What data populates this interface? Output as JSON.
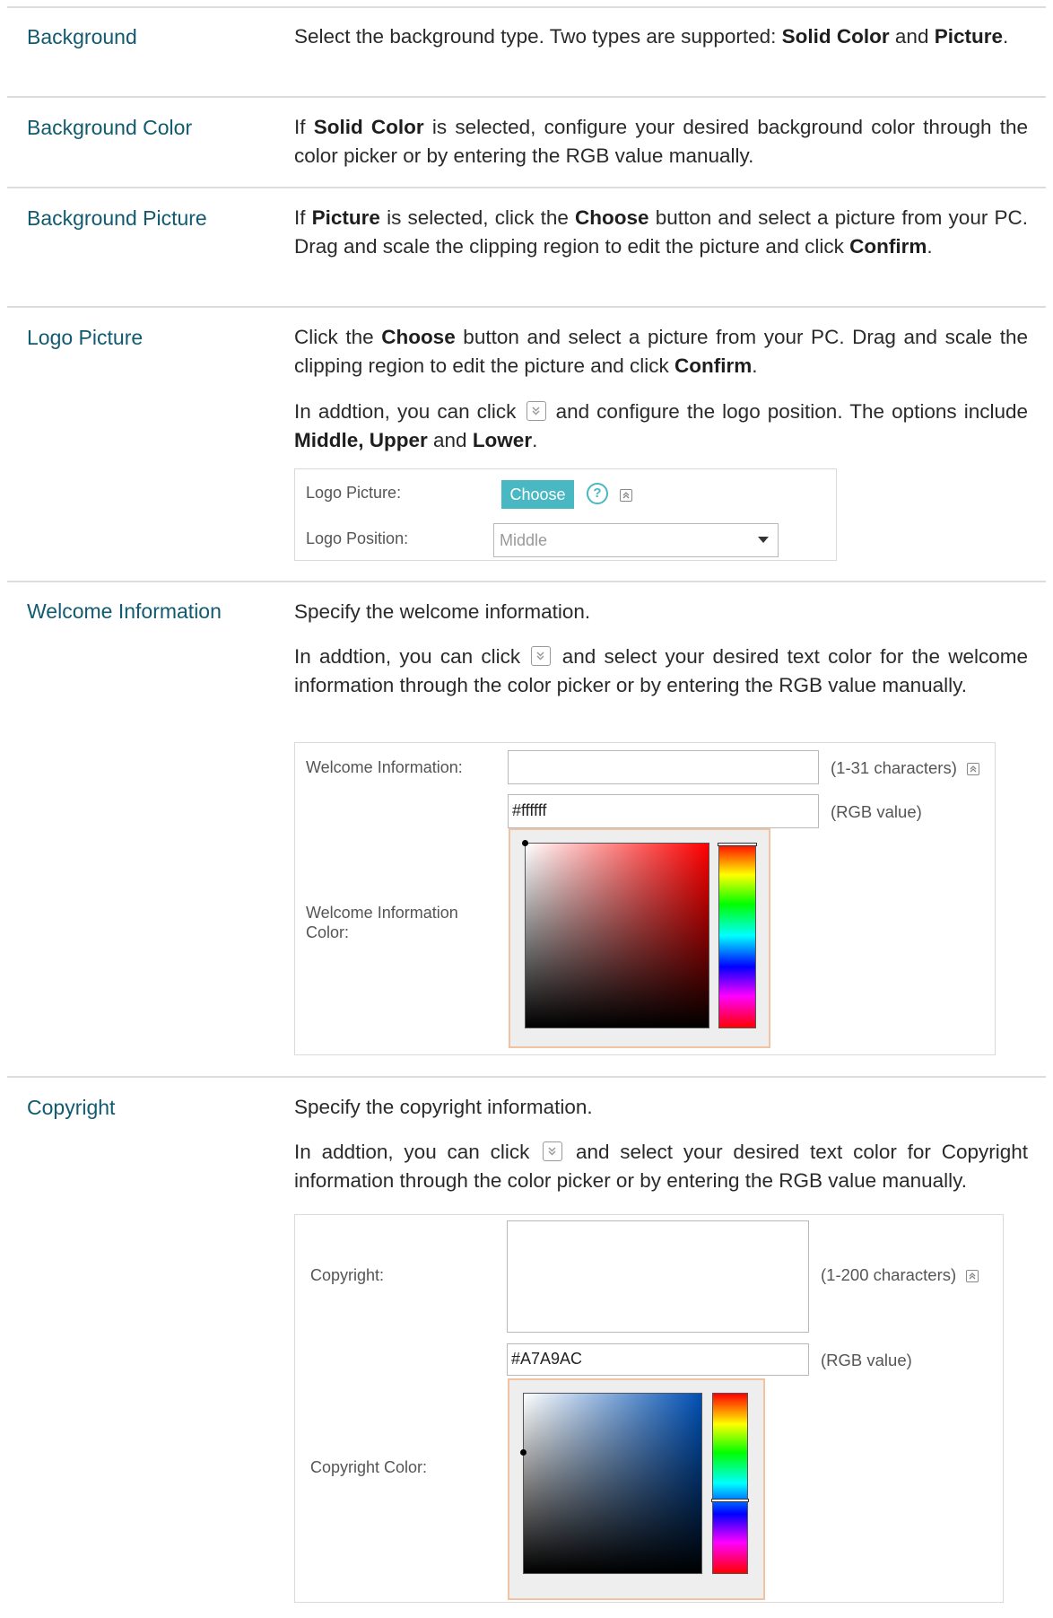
{
  "rows": [
    {
      "term": "Background",
      "paras": [
        [
          "Select the background type. Two types are supported: ",
          {
            "b": "Solid Color"
          },
          " and ",
          {
            "b": "Picture"
          },
          "."
        ]
      ]
    },
    {
      "term": "Background Color",
      "paras": [
        [
          "If ",
          {
            "b": "Solid Color"
          },
          " is selected, configure your desired background color through the color picker or by entering the RGB value manually."
        ]
      ]
    },
    {
      "term": "Background Picture",
      "paras": [
        [
          "If ",
          {
            "b": "Picture"
          },
          " is selected, click the ",
          {
            "b": "Choose"
          },
          " button and select a picture from your PC. Drag and scale the clipping region to edit the picture and click ",
          {
            "b": "Confirm"
          },
          "."
        ]
      ]
    },
    {
      "term": "Logo Picture",
      "paras": [
        [
          "Click the ",
          {
            "b": "Choose"
          },
          " button and select a picture from your PC. Drag and scale the clipping region to edit the picture and click ",
          {
            "b": "Confirm"
          },
          "."
        ],
        [
          "In addtion, you can click ",
          {
            "icon": "expand-icon"
          },
          " and configure the logo position. The options include ",
          {
            "b": "Middle, Upper"
          },
          " and ",
          {
            "b": "Lower"
          },
          "."
        ]
      ]
    },
    {
      "term": "Welcome Information",
      "paras": [
        [
          "Specify the welcome information."
        ],
        [
          "In addtion, you can click ",
          {
            "icon": "expand-icon"
          },
          " and select your desired text color for the welcome information through the color picker or by entering the RGB value manually."
        ]
      ]
    },
    {
      "term": "Copyright",
      "paras": [
        [
          "Specify the copyright information."
        ],
        [
          "In addtion, you can click ",
          {
            "icon": "expand-icon"
          },
          " and select your desired text color for Copyright information through the color picker or by entering the RGB value manually."
        ]
      ]
    }
  ],
  "logo_panel": {
    "logo_picture_label": "Logo Picture:",
    "choose_button": "Choose",
    "help_icon": "?",
    "collapse_icon": "collapse-icon",
    "logo_position_label": "Logo Position:",
    "logo_position_value": "Middle"
  },
  "welcome_panel": {
    "welcome_label": "Welcome Information:",
    "welcome_value": "",
    "welcome_hint": "(1-31 characters)",
    "color_value": "#ffffff",
    "color_hint": "(RGB value)",
    "color_label": "Welcome Information Color:",
    "picker_hue_color": "#ff0000"
  },
  "copyright_panel": {
    "copyright_label": "Copyright:",
    "copyright_value": "",
    "copyright_hint": "(1-200 characters)",
    "color_value": "#A7A9AC",
    "color_hint": "(RGB value)",
    "color_label": "Copyright Color:",
    "picker_hue_color": "#0050b4"
  },
  "colors": {
    "term": "#115a6f",
    "accent": "#4ab8c2",
    "picker_border": "#f2c3a2"
  }
}
